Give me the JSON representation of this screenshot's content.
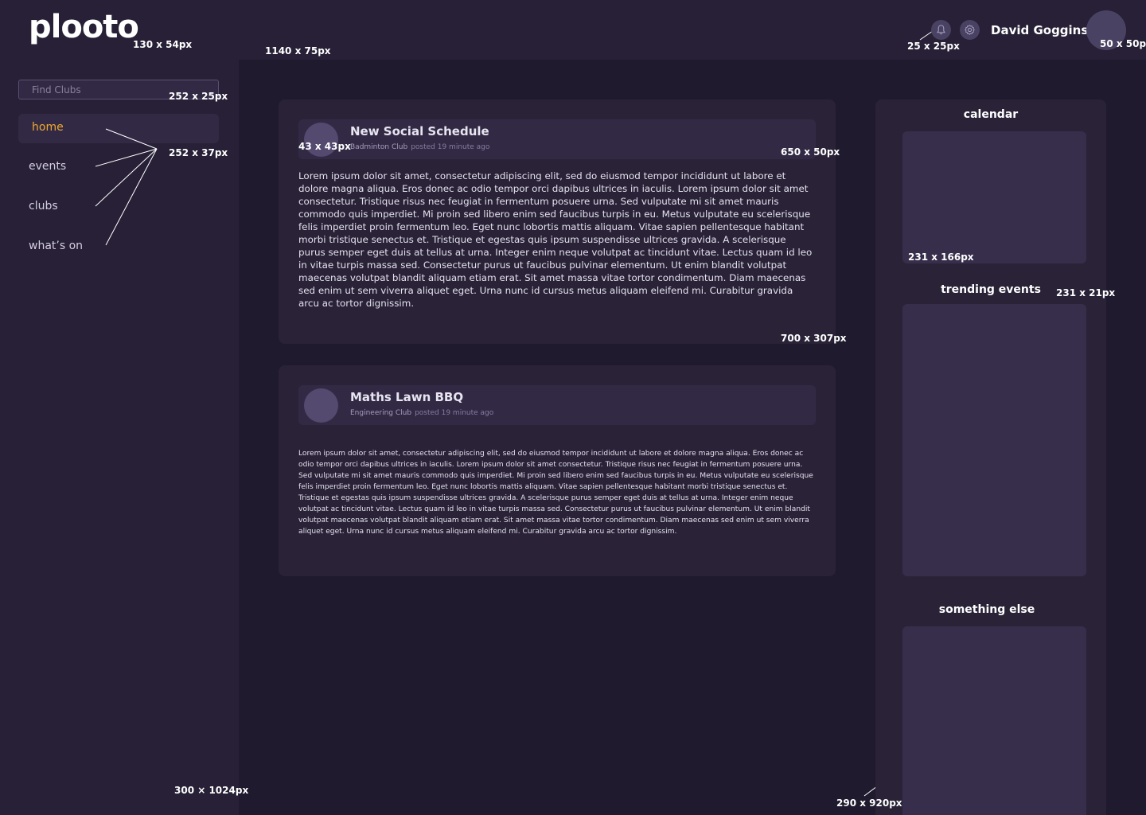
{
  "app": {
    "logo": "plooto"
  },
  "search": {
    "placeholder": "Find Clubs"
  },
  "nav": {
    "items": [
      {
        "label": "home"
      },
      {
        "label": "events"
      },
      {
        "label": "clubs"
      },
      {
        "label": "what’s on"
      }
    ]
  },
  "header": {
    "user_name": "David Goggins"
  },
  "posts": [
    {
      "title": "New Social Schedule",
      "club": "Badminton Club",
      "posted": "posted 19 minute ago",
      "body": "Lorem ipsum dolor sit amet, consectetur adipiscing elit, sed do eiusmod tempor incididunt ut labore et dolore magna aliqua. Eros donec ac odio tempor orci dapibus ultrices in iaculis. Lorem ipsum dolor sit amet consectetur. Tristique risus nec feugiat in fermentum posuere urna. Sed vulputate mi sit amet mauris commodo quis imperdiet. Mi proin sed libero enim sed faucibus turpis in eu. Metus vulputate eu scelerisque felis imperdiet proin fermentum leo. Eget nunc lobortis mattis aliquam. Vitae sapien pellentesque habitant morbi tristique senectus et. Tristique et egestas quis ipsum suspendisse ultrices gravida. A scelerisque purus semper eget duis at tellus at urna. Integer enim neque volutpat ac tincidunt vitae. Lectus quam id leo in vitae turpis massa sed. Consectetur purus ut faucibus pulvinar elementum. Ut enim blandit volutpat maecenas volutpat blandit aliquam etiam erat. Sit amet massa vitae tortor condimentum. Diam maecenas sed enim ut sem viverra aliquet eget. Urna nunc id cursus metus aliquam eleifend mi. Curabitur gravida arcu ac tortor dignissim."
    },
    {
      "title": "Maths Lawn BBQ",
      "club": "Engineering Club",
      "posted": "posted 19 minute ago",
      "body": "Lorem ipsum dolor sit amet, consectetur adipiscing elit, sed do eiusmod tempor incididunt ut labore et dolore magna aliqua. Eros donec ac odio tempor orci dapibus ultrices in iaculis. Lorem ipsum dolor sit amet consectetur. Tristique risus nec feugiat in fermentum posuere urna. Sed vulputate mi sit amet mauris commodo quis imperdiet. Mi proin sed libero enim sed faucibus turpis in eu. Metus vulputate eu scelerisque felis imperdiet proin fermentum leo. Eget nunc lobortis mattis aliquam. Vitae sapien pellentesque habitant morbi tristique senectus et. Tristique et egestas quis ipsum suspendisse ultrices gravida. A scelerisque purus semper eget duis at tellus at urna. Integer enim neque volutpat ac tincidunt vitae. Lectus quam id leo in vitae turpis massa sed. Consectetur purus ut faucibus pulvinar elementum. Ut enim blandit volutpat maecenas volutpat blandit aliquam etiam erat. Sit amet massa vitae tortor condimentum. Diam maecenas sed enim ut sem viverra aliquet eget. Urna nunc id cursus metus aliquam eleifend mi. Curabitur gravida arcu ac tortor dignissim."
    }
  ],
  "right_panel": {
    "calendar_title": "calendar",
    "trending_title": "trending events",
    "something_else_title": "something else"
  },
  "annotations": {
    "logo": "130 x 54px",
    "topbar": "1140 x 75px",
    "search": "252 x 25px",
    "nav_item": "252 x 37px",
    "icon": "25 x 25px",
    "avatar": "50 x 50px",
    "post_avatar": "43 x 43px",
    "post_header": "650 x 50px",
    "post_card": "700 x 307px",
    "calendar": "231 x 166px",
    "panel_title": "231 x 21px",
    "sidebar": "300 × 1024px",
    "right_panel": "290 x 920px"
  },
  "colors": {
    "background": "#1f1a2e",
    "sidebar": "#272036",
    "card": "#2a2338",
    "accent": "#f0a830"
  },
  "icons": {
    "notification": "bell-icon",
    "settings": "gear-icon"
  }
}
